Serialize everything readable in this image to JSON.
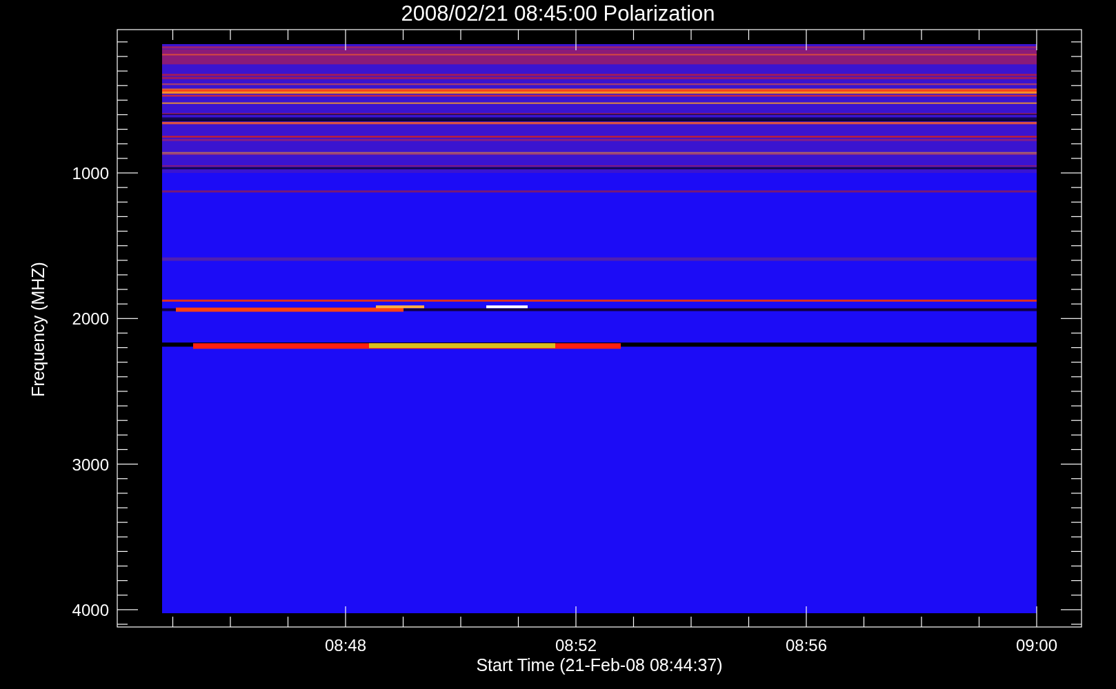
{
  "title": "2008/02/21 08:45:00 Polarization",
  "y_axis": {
    "label": "Frequency (MHZ)",
    "ticks": [
      "1000",
      "2000",
      "3000",
      "4000"
    ]
  },
  "x_axis": {
    "label": "Start Time (21-Feb-08 08:44:37)",
    "ticks": [
      "08:48",
      "08:52",
      "08:56",
      "09:00"
    ]
  }
}
